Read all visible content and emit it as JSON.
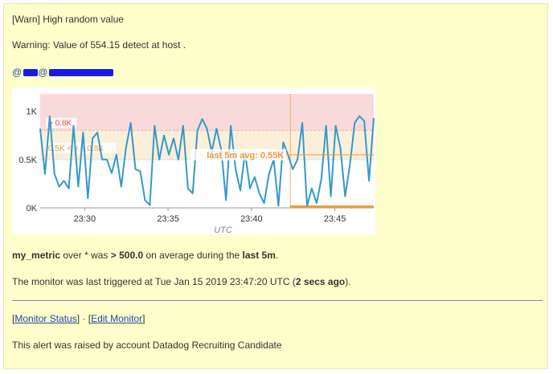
{
  "alert": {
    "title": "[Warn] High random value",
    "warning_text": "Warning: Value of 554.15 detect at host .",
    "mention_prefix": "@",
    "mention_middle": "@",
    "summary": {
      "metric": "my_metric",
      "over": " over ",
      "scope": "*",
      "was": " was ",
      "threshold": "> 500.0",
      "on_avg": " on average during the ",
      "window": "last 5m",
      "end": "."
    },
    "triggered": {
      "prefix": "The monitor was last triggered at Tue Jan 15 2019 23:47:20 UTC (",
      "ago": "2 secs ago",
      "suffix": ")."
    },
    "links": {
      "status_label": "Monitor Status",
      "edit_label": "Edit Monitor",
      "separator": " · "
    },
    "footer": "This alert was raised by account Datadog Recruiting Candidate"
  },
  "colors": {
    "background": "#ffffcc",
    "line": "#3399cc",
    "alert_band": "#f9d9d9",
    "warn_band": "#fcefd9",
    "alert_text": "#e05050",
    "warn_text": "#f09a3a"
  },
  "chart_data": {
    "type": "line",
    "xlabel": "UTC",
    "x_ticks": [
      "23:30",
      "23:35",
      "23:40",
      "23:45"
    ],
    "x_range": [
      "23:27:20",
      "23:47:20"
    ],
    "y_ticks": [
      "1K",
      "0.5K",
      "0K"
    ],
    "ylim": [
      0,
      1.18
    ],
    "y_unit": "K",
    "grid": true,
    "thresholds": [
      {
        "label": "> 0.8K",
        "from": 0.8,
        "to": 1.18,
        "kind": "alert"
      },
      {
        "label": "0.5K < y < 0.8K",
        "from": 0.5,
        "to": 0.8,
        "kind": "warn"
      }
    ],
    "annotation": "last 5m avg: 0.55K",
    "eval_window": {
      "from": "23:42:20",
      "to": "23:47:20"
    },
    "series": [
      {
        "values": [
          0.82,
          0.35,
          0.95,
          0.35,
          0.22,
          0.28,
          0.2,
          0.85,
          0.22,
          0.78,
          0.1,
          0.72,
          0.78,
          0.5,
          0.5,
          0.36,
          0.55,
          0.22,
          0.62,
          0.88,
          0.4,
          0.38,
          0.08,
          0.03,
          0.85,
          0.5,
          0.75,
          0.55,
          0.72,
          0.5,
          0.85,
          0.2,
          0.15,
          0.8,
          0.92,
          0.82,
          0.58,
          0.82,
          0.6,
          0.08,
          0.85,
          0.4,
          0.18,
          0.58,
          0.2,
          0.32,
          0.15,
          0.05,
          0.35,
          0.5,
          0.02,
          0.68,
          0.55,
          0.4,
          0.5,
          0.88,
          0.02,
          0.2,
          0.05,
          0.3,
          0.85,
          0.12,
          0.85,
          0.62,
          0.12,
          0.45,
          0.88,
          0.95,
          0.9,
          0.28,
          0.93
        ]
      }
    ]
  }
}
